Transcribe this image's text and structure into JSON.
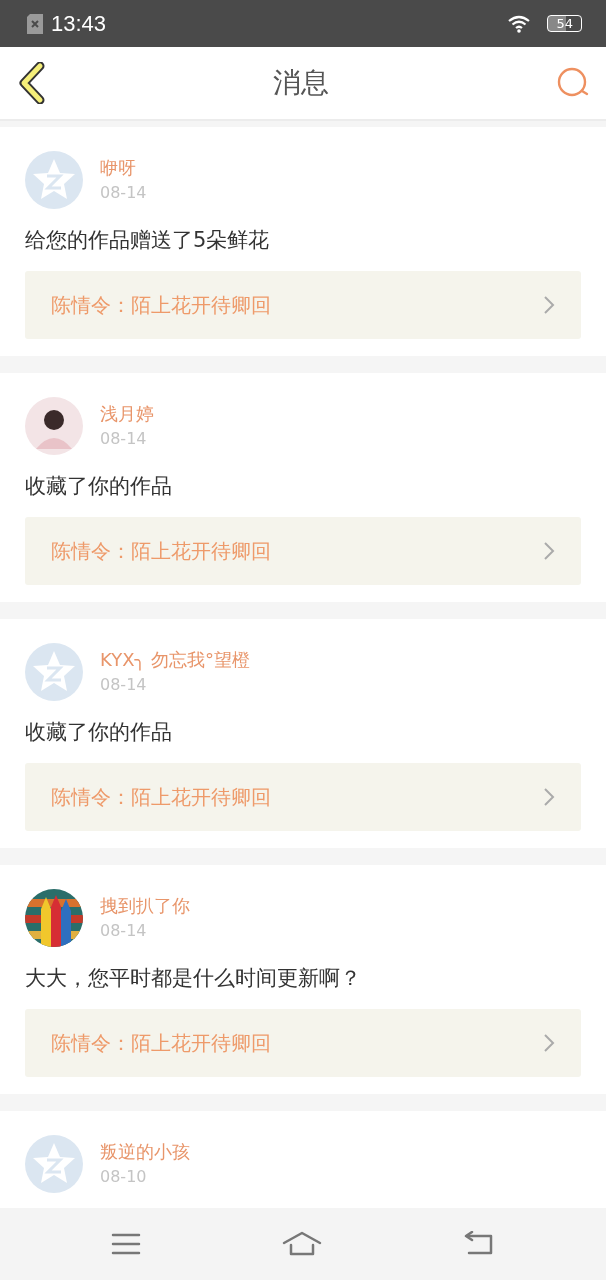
{
  "status_bar": {
    "time": "13:43",
    "battery": "54"
  },
  "header": {
    "title": "消息"
  },
  "messages": [
    {
      "avatar": {
        "kind": "default"
      },
      "name": "咿呀",
      "date": "08-14",
      "text": "给您的作品赠送了5朵鲜花",
      "work": "陈情令：陌上花开待卿回"
    },
    {
      "avatar": {
        "kind": "person"
      },
      "name": "浅月婷",
      "date": "08-14",
      "text": "收藏了你的作品",
      "work": "陈情令：陌上花开待卿回"
    },
    {
      "avatar": {
        "kind": "default"
      },
      "name": "KYX╮ 勿忘我°望橙",
      "date": "08-14",
      "text": "收藏了你的作品",
      "work": "陈情令：陌上花开待卿回"
    },
    {
      "name": "拽到扒了你",
      "date": "08-14",
      "text": "大大，您平时都是什么时间更新啊？",
      "work": "陈情令：陌上花开待卿回"
    },
    {
      "avatar": {
        "kind": "default"
      },
      "name": "叛逆的小孩",
      "date": "08-10"
    }
  ]
}
